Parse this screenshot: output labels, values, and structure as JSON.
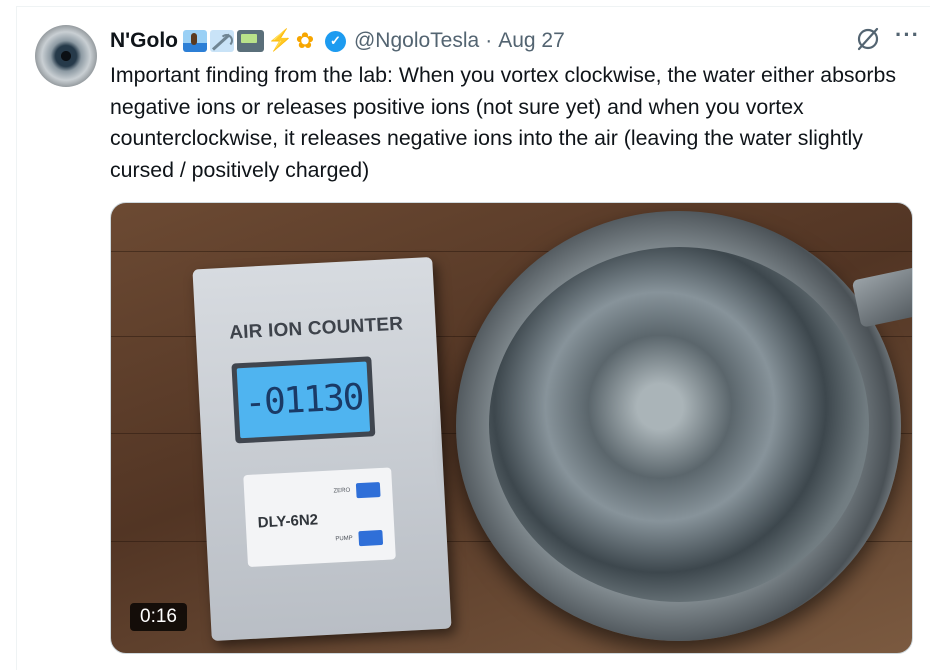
{
  "author": {
    "name": "N'Golo",
    "emoji_icons": [
      "surfer-icon",
      "antenna-icon",
      "pager-icon",
      "lightning-icon",
      "sunflower-icon"
    ],
    "verified": true,
    "handle": "@NgoloTesla",
    "separator": "·",
    "date": "Aug 27"
  },
  "tweet": {
    "text": "Important finding from the lab: When you vortex clockwise, the water either absorbs negative ions or releases positive ions (not sure yet) and when you vortex counterclockwise, it releases negative ions into the air (leaving the water slightly cursed / positively charged)"
  },
  "media": {
    "device_title": "AIR ION COUNTER",
    "lcd_reading": "-01130",
    "model": "DLY-6N2",
    "zero_label": "ZERO",
    "pump_label": "PUMP",
    "duration": "0:16"
  },
  "icons": {
    "grok": "grok-icon",
    "more": "more-icon",
    "verified": "verified-icon"
  },
  "colors": {
    "verified": "#1d9bf0",
    "secondary_text": "#536471",
    "primary_text": "#0f1419"
  }
}
